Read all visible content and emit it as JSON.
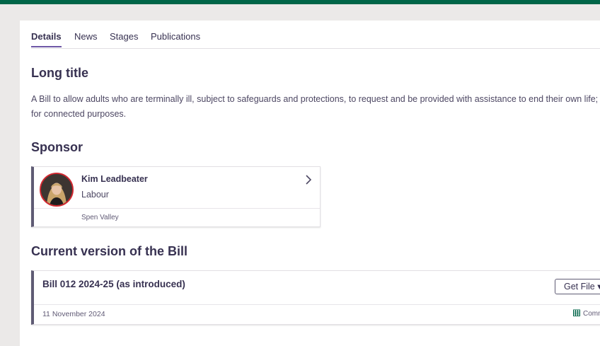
{
  "tabs": [
    {
      "label": "Details",
      "active": true
    },
    {
      "label": "News",
      "active": false
    },
    {
      "label": "Stages",
      "active": false
    },
    {
      "label": "Publications",
      "active": false
    }
  ],
  "long_title": {
    "heading": "Long title",
    "text": "A Bill to allow adults who are terminally ill, subject to safeguards and protections, to request and be provided with assistance to end their own life; and for connected purposes."
  },
  "sponsor": {
    "heading": "Sponsor",
    "name": "Kim Leadbeater",
    "party": "Labour",
    "constituency": "Spen Valley",
    "party_color": "#d12830",
    "icon": "chevron-right-icon"
  },
  "current_version": {
    "heading": "Current version of the Bill",
    "bill_title": "Bill 012 2024-25 (as introduced)",
    "get_file_label": "Get File",
    "date": "11 November 2024",
    "house": "Commons",
    "house_color": "#006548"
  },
  "colors": {
    "top_bar": "#006548",
    "tab_underline": "#6e58a6",
    "card_accent": "#5f5b74",
    "background": "#ebe9e8"
  }
}
